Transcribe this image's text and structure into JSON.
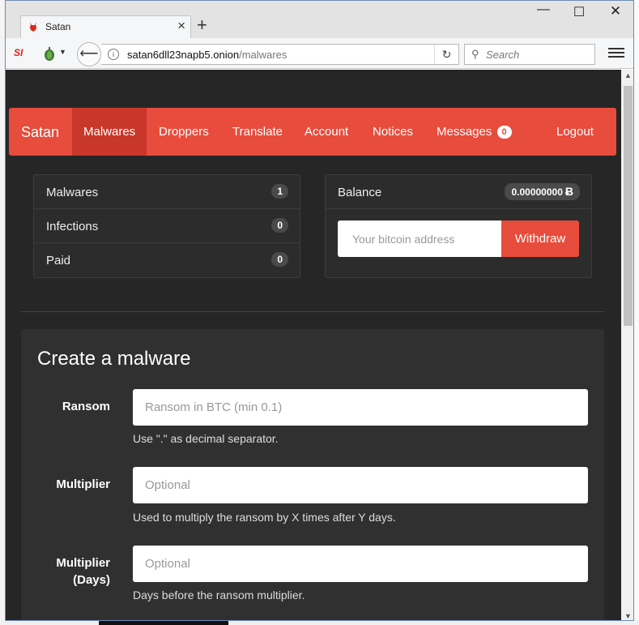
{
  "browser": {
    "tab_title": "Satan",
    "new_tab_label": "+",
    "url_host": "satan6dll23napb5.onion",
    "url_path": "/malwares",
    "search_placeholder": "Search",
    "ext_si_label": "SI"
  },
  "site": {
    "brand": "Satan",
    "nav": {
      "malwares": "Malwares",
      "droppers": "Droppers",
      "translate": "Translate",
      "account": "Account",
      "notices": "Notices",
      "messages": "Messages",
      "messages_count": "0",
      "logout": "Logout"
    }
  },
  "stats": [
    {
      "label": "Malwares",
      "value": "1"
    },
    {
      "label": "Infections",
      "value": "0"
    },
    {
      "label": "Paid",
      "value": "0"
    }
  ],
  "balance": {
    "label": "Balance",
    "amount": "0.00000000",
    "currency_symbol": "Ƀ",
    "address_placeholder": "Your bitcoin address",
    "withdraw_label": "Withdraw"
  },
  "form": {
    "title": "Create a malware",
    "ransom": {
      "label": "Ransom",
      "placeholder": "Ransom in BTC (min 0.1)",
      "help": "Use \".\" as decimal separator."
    },
    "multiplier": {
      "label": "Multiplier",
      "placeholder": "Optional",
      "help": "Used to multiply the ransom by X times after Y days."
    },
    "multiplier_days": {
      "label_line1": "Multiplier",
      "label_line2": "(Days)",
      "placeholder": "Optional",
      "help": "Days before the ransom multiplier."
    }
  },
  "colors": {
    "accent": "#e74c3c",
    "accent_active": "#c9372a",
    "page_bg": "#262626",
    "panel_bg": "#2c2c2c",
    "card_bg": "#303030"
  },
  "icons": {
    "tab_favicon": "devil-icon",
    "back": "back-arrow-icon",
    "info": "info-icon",
    "reload": "reload-icon",
    "search": "search-icon",
    "menu": "hamburger-menu-icon"
  }
}
